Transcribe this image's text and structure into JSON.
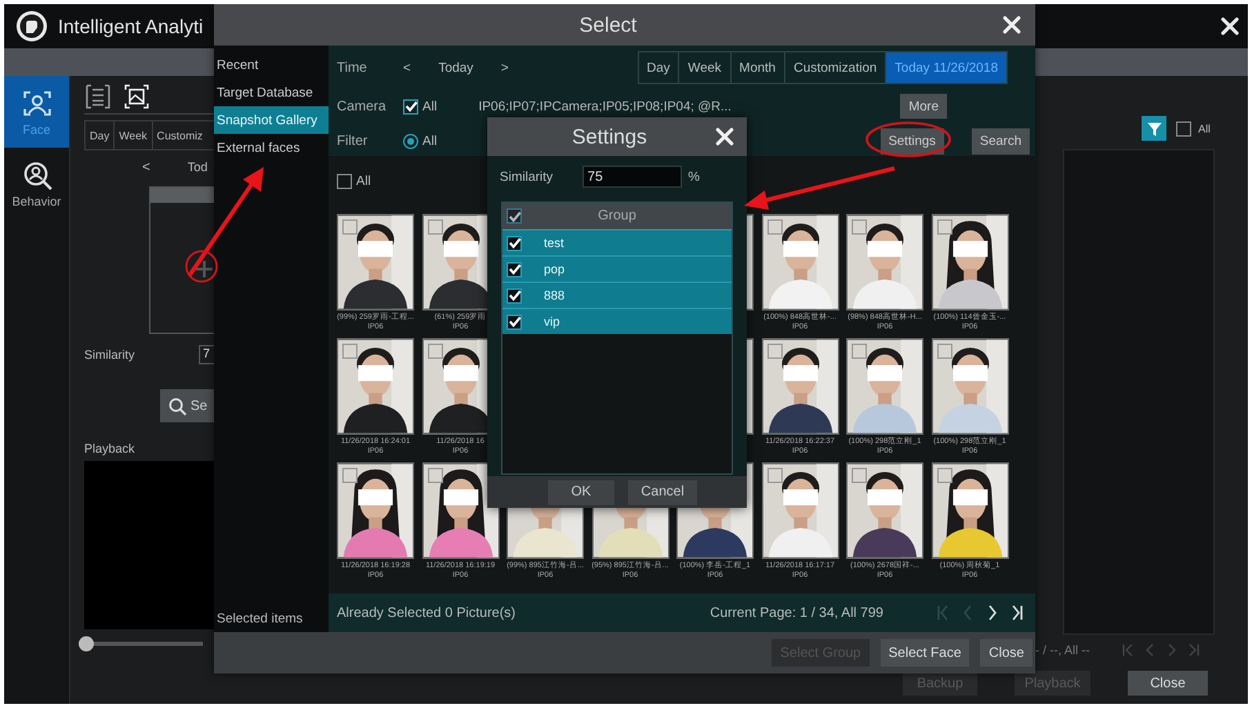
{
  "app": {
    "title": "Intelligent Analyti",
    "nav": [
      {
        "label": "Face",
        "selected": true
      },
      {
        "label": "Behavior",
        "selected": false
      }
    ],
    "view_modes": [
      {
        "selected": false
      },
      {
        "selected": true
      }
    ],
    "view_tabs": [
      "Day",
      "Week",
      "Customiz"
    ],
    "date_nav": {
      "prev": "<",
      "label": "Tod"
    },
    "similarity": {
      "label": "Similarity",
      "value": "7"
    },
    "search_button": "Se",
    "playback": {
      "label": "Playback",
      "level": 0
    },
    "select_all": {
      "label": "All",
      "checked": false
    },
    "page_info": "- / --, All --",
    "buttons": [
      {
        "label": "Backup",
        "disabled": true
      },
      {
        "label": "Playback",
        "disabled": true
      },
      {
        "label": "Close",
        "disabled": false
      }
    ]
  },
  "select_dialog": {
    "title": "Select",
    "sidebar": [
      {
        "label": "Recent",
        "selected": false
      },
      {
        "label": "Target Database",
        "selected": false
      },
      {
        "label": "Snapshot Gallery",
        "selected": true
      },
      {
        "label": "External faces",
        "selected": false
      }
    ],
    "selected_items_label": "Selected items",
    "time": {
      "label": "Time",
      "prev": "<",
      "value": "Today",
      "next": ">",
      "ranges": [
        {
          "label": "Day",
          "selected": false
        },
        {
          "label": "Week",
          "selected": false
        },
        {
          "label": "Month",
          "selected": false
        },
        {
          "label": "Customization",
          "selected": false
        },
        {
          "label": "Today 11/26/2018",
          "selected": true
        }
      ]
    },
    "camera": {
      "label": "Camera",
      "all": {
        "label": "All",
        "checked": true
      },
      "list": "IP06;IP07;IPCamera;IP05;IP08;IP04;  @R...",
      "more_button": "More"
    },
    "filter": {
      "label": "Filter",
      "options": [
        {
          "label": "All",
          "selected": true
        }
      ],
      "settings_button": "Settings",
      "search_button": "Search"
    },
    "select_all": {
      "label": "All",
      "checked": false
    },
    "snapshots": [
      {
        "kind": "snapshot",
        "checked": false,
        "caption": "(99%) 259罗雨-工程...",
        "camera": "IP06"
      },
      {
        "kind": "snapshot",
        "checked": false,
        "caption": "(61%) 259罗雨",
        "camera": "IP06"
      },
      {
        "kind": "covered"
      },
      {
        "kind": "covered"
      },
      {
        "kind": "picture"
      },
      {
        "kind": "snapshot",
        "checked": false,
        "caption": "(100%) 848高世林-...",
        "camera": "IP06"
      },
      {
        "kind": "snapshot",
        "checked": false,
        "caption": "(98%) 848高世林-H...",
        "camera": "IP06"
      },
      {
        "kind": "snapshot",
        "checked": false,
        "caption": "(100%) 114曾金玉-...",
        "camera": "IP06"
      },
      {
        "kind": "snapshot",
        "checked": false,
        "caption": "11/26/2018 16:24:01",
        "camera": "IP06"
      },
      {
        "kind": "snapshot",
        "checked": false,
        "caption": "11/26/2018 16",
        "camera": "IP06"
      },
      {
        "kind": "covered"
      },
      {
        "kind": "covered"
      },
      {
        "kind": "picture"
      },
      {
        "kind": "snapshot",
        "checked": false,
        "caption": "11/26/2018 16:22:37",
        "camera": "IP06"
      },
      {
        "kind": "snapshot",
        "checked": false,
        "caption": "(100%) 298范立刚_1",
        "camera": "IP06"
      },
      {
        "kind": "snapshot",
        "checked": false,
        "caption": "(100%) 298范立刚_1",
        "camera": "IP06"
      },
      {
        "kind": "snapshot",
        "checked": false,
        "caption": "11/26/2018 16:19:28",
        "camera": "IP06"
      },
      {
        "kind": "snapshot",
        "checked": false,
        "caption": "11/26/2018 16:19:19",
        "camera": "IP06"
      },
      {
        "kind": "snapshot",
        "caption": "(99%) 895江竹海-吕...",
        "camera": "IP06"
      },
      {
        "kind": "snapshot",
        "caption": "(95%) 895江竹海-吕...",
        "camera": "IP06"
      },
      {
        "kind": "snapshot",
        "caption": "(100%) 李岳-工程_1",
        "camera": "IP06"
      },
      {
        "kind": "snapshot",
        "checked": false,
        "caption": "11/26/2018 16:17:17",
        "camera": "IP06"
      },
      {
        "kind": "snapshot",
        "checked": false,
        "caption": "(100%) 2678国祥-...",
        "camera": "IP06"
      },
      {
        "kind": "snapshot",
        "checked": false,
        "caption": "(100%) 周秋菊_1",
        "camera": "IP06"
      }
    ],
    "selected_count": "Already Selected 0 Picture(s)",
    "page_info": "Current Page: 1 / 34, All 799",
    "buttons": [
      {
        "label": "Select Group",
        "disabled": true
      },
      {
        "label": "Select Face",
        "disabled": false
      },
      {
        "label": "Close",
        "disabled": false
      }
    ]
  },
  "settings_dialog": {
    "title": "Settings",
    "similarity": {
      "label": "Similarity",
      "value": "75",
      "unit": "%"
    },
    "group_header": {
      "label": "Group",
      "checked": true
    },
    "groups": [
      {
        "label": "test",
        "checked": true
      },
      {
        "label": "pop",
        "checked": true
      },
      {
        "label": "888",
        "checked": true
      },
      {
        "label": "vip",
        "checked": true
      }
    ],
    "buttons": [
      "OK",
      "Cancel"
    ]
  }
}
